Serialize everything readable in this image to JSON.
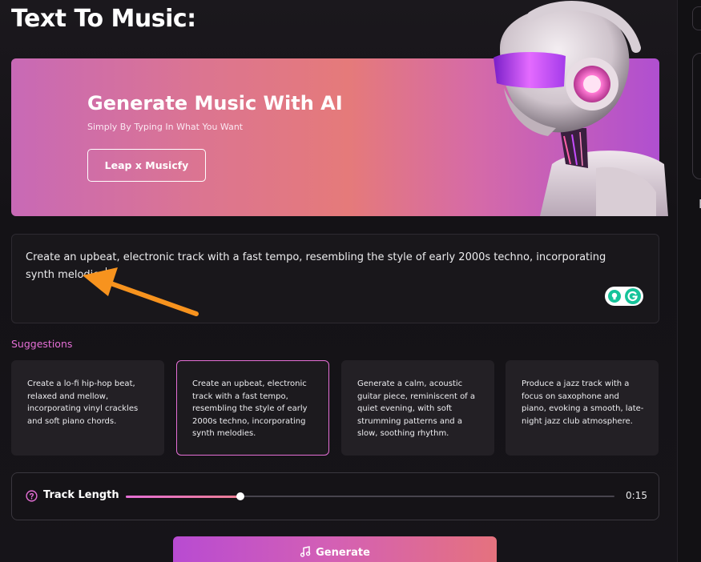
{
  "page": {
    "title": "Text To Music:"
  },
  "hero": {
    "title": "Generate Music With AI",
    "subtitle": "Simply By Typing In What You Want",
    "button_label": "Leap x Musicfy"
  },
  "prompt": {
    "value": "Create an upbeat, electronic track with a fast tempo, resembling the style of early 2000s techno, incorporating synth melodies"
  },
  "suggestions": {
    "label": "Suggestions",
    "items": [
      {
        "text": "Create a lo-fi hip-hop beat, relaxed and mellow, incorporating vinyl crackles and soft piano chords.",
        "selected": false
      },
      {
        "text": "Create an upbeat, electronic track with a fast tempo, resembling the style of early 2000s techno, incorporating synth melodies.",
        "selected": true
      },
      {
        "text": "Generate a calm, acoustic guitar piece, reminiscent of a quiet evening, with soft strumming patterns and a slow, soothing rhythm.",
        "selected": false
      },
      {
        "text": "Produce a jazz track with a focus on saxophone and piano, evoking a smooth, late-night jazz club atmosphere.",
        "selected": false
      }
    ]
  },
  "track_length": {
    "label": "Track Length",
    "value": "0:15",
    "slider_fraction": 0.235
  },
  "generate": {
    "label": "Generate"
  },
  "icons": {
    "help": "question-circle-icon",
    "note": "music-note-icon",
    "arrow": "annotation-arrow-icon"
  },
  "colors": {
    "accent_pink": "#e56fd6",
    "arrow_orange": "#f7931e",
    "hero_gradient_start": "#c869b6",
    "hero_gradient_end": "#b04fd0",
    "background": "#141216"
  }
}
